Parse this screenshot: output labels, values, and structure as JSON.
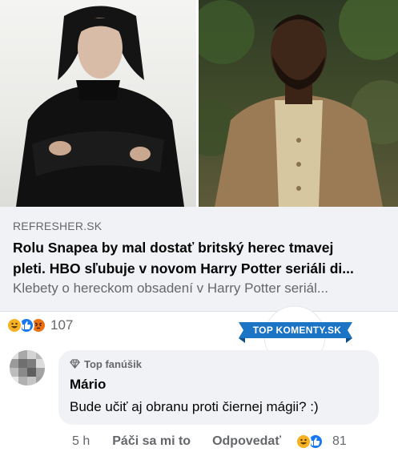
{
  "link_preview": {
    "source": "REFRESHER.SK",
    "headline_line1": "Rolu Snapea by mal dostať britský herec tmavej",
    "headline_line2": "pleti. HBO sľubuje v novom Harry Potter seriáli di...",
    "description": "Klebety o hereckom obsadení v Harry Potter seriál..."
  },
  "post_reactions": {
    "icons": [
      "haha-icon",
      "like-icon",
      "angry-icon"
    ],
    "count": "107"
  },
  "badge": {
    "text": "TOP KOMENTY.SK",
    "color": "#1b74c4"
  },
  "comment": {
    "fan_label": "Top fanúšik",
    "author": "Mário",
    "text": "Bude učiť aj obranu proti čiernej mágii? :)",
    "time": "5 h",
    "like_label": "Páči sa mi to",
    "reply_label": "Odpovedať",
    "reaction_count": "81"
  },
  "colors": {
    "like_blue": "#1877f2",
    "haha_yellow": "#f7b125",
    "angry_orange": "#e9710f",
    "secondary_text": "#65676b",
    "bubble_bg": "#f0f2f5"
  }
}
